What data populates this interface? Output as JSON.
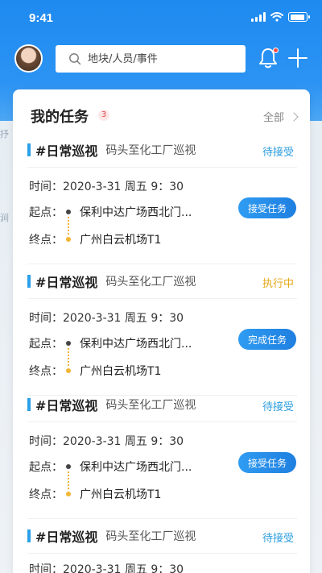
{
  "status_bar": {
    "time": "9:41"
  },
  "toolbar": {
    "search_placeholder": "地块/人员/事件"
  },
  "map": {
    "labels": [
      "抒",
      "涧"
    ]
  },
  "card": {
    "title": "我的任务",
    "count": "3",
    "all_label": "全部"
  },
  "tasks": [
    {
      "type": "#日常巡视",
      "name": "码头至化工厂巡视",
      "status": "待接受",
      "status_color": "#2a9de0",
      "time": "时间：2020-3-31 周五 9：30",
      "start_label": "起点：",
      "start": "保利中达广场西北门...",
      "end_label": "终点：",
      "end": "广州白云机场T1",
      "action": "接受任务"
    },
    {
      "type": "#日常巡视",
      "name": "码头至化工厂巡视",
      "status": "执行中",
      "status_color": "#e6a817",
      "time": "时间：2020-3-31 周五 9：30",
      "start_label": "起点：",
      "start": "保利中达广场西北门...",
      "end_label": "终点：",
      "end": "广州白云机场T1",
      "action": "完成任务"
    },
    {
      "type": "#日常巡视",
      "name": "码头至化工厂巡视",
      "status": "待接受",
      "status_color": "#2a9de0",
      "time": "时间：2020-3-31 周五 9：30",
      "start_label": "起点：",
      "start": "保利中达广场西北门...",
      "end_label": "终点：",
      "end": "广州白云机场T1",
      "action": "接受任务"
    },
    {
      "type": "#日常巡视",
      "name": "码头至化工厂巡视",
      "status": "待接受",
      "status_color": "#2a9de0",
      "time": "时间：2020-3-31 周五 9：30"
    }
  ]
}
